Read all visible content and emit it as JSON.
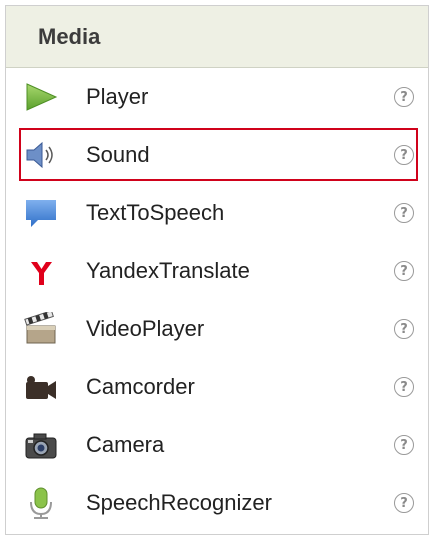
{
  "panel": {
    "title": "Media"
  },
  "items": [
    {
      "label": "Player",
      "icon": "play-triangle-icon",
      "help": "?"
    },
    {
      "label": "Sound",
      "icon": "speaker-icon",
      "help": "?",
      "selected": true
    },
    {
      "label": "TextToSpeech",
      "icon": "speech-bubble-icon",
      "help": "?"
    },
    {
      "label": "YandexTranslate",
      "icon": "yandex-logo-icon",
      "help": "?"
    },
    {
      "label": "VideoPlayer",
      "icon": "clapperboard-icon",
      "help": "?"
    },
    {
      "label": "Camcorder",
      "icon": "camcorder-icon",
      "help": "?"
    },
    {
      "label": "Camera",
      "icon": "camera-icon",
      "help": "?"
    },
    {
      "label": "SpeechRecognizer",
      "icon": "microphone-icon",
      "help": "?"
    }
  ],
  "colors": {
    "header_bg": "#eef0e4",
    "selection_border": "#d0021b",
    "player_icon": "#7cc043",
    "tts_icon": "#3f7fd4",
    "yandex_icon": "#e0001b",
    "speech_icon": "#8bc34a"
  }
}
